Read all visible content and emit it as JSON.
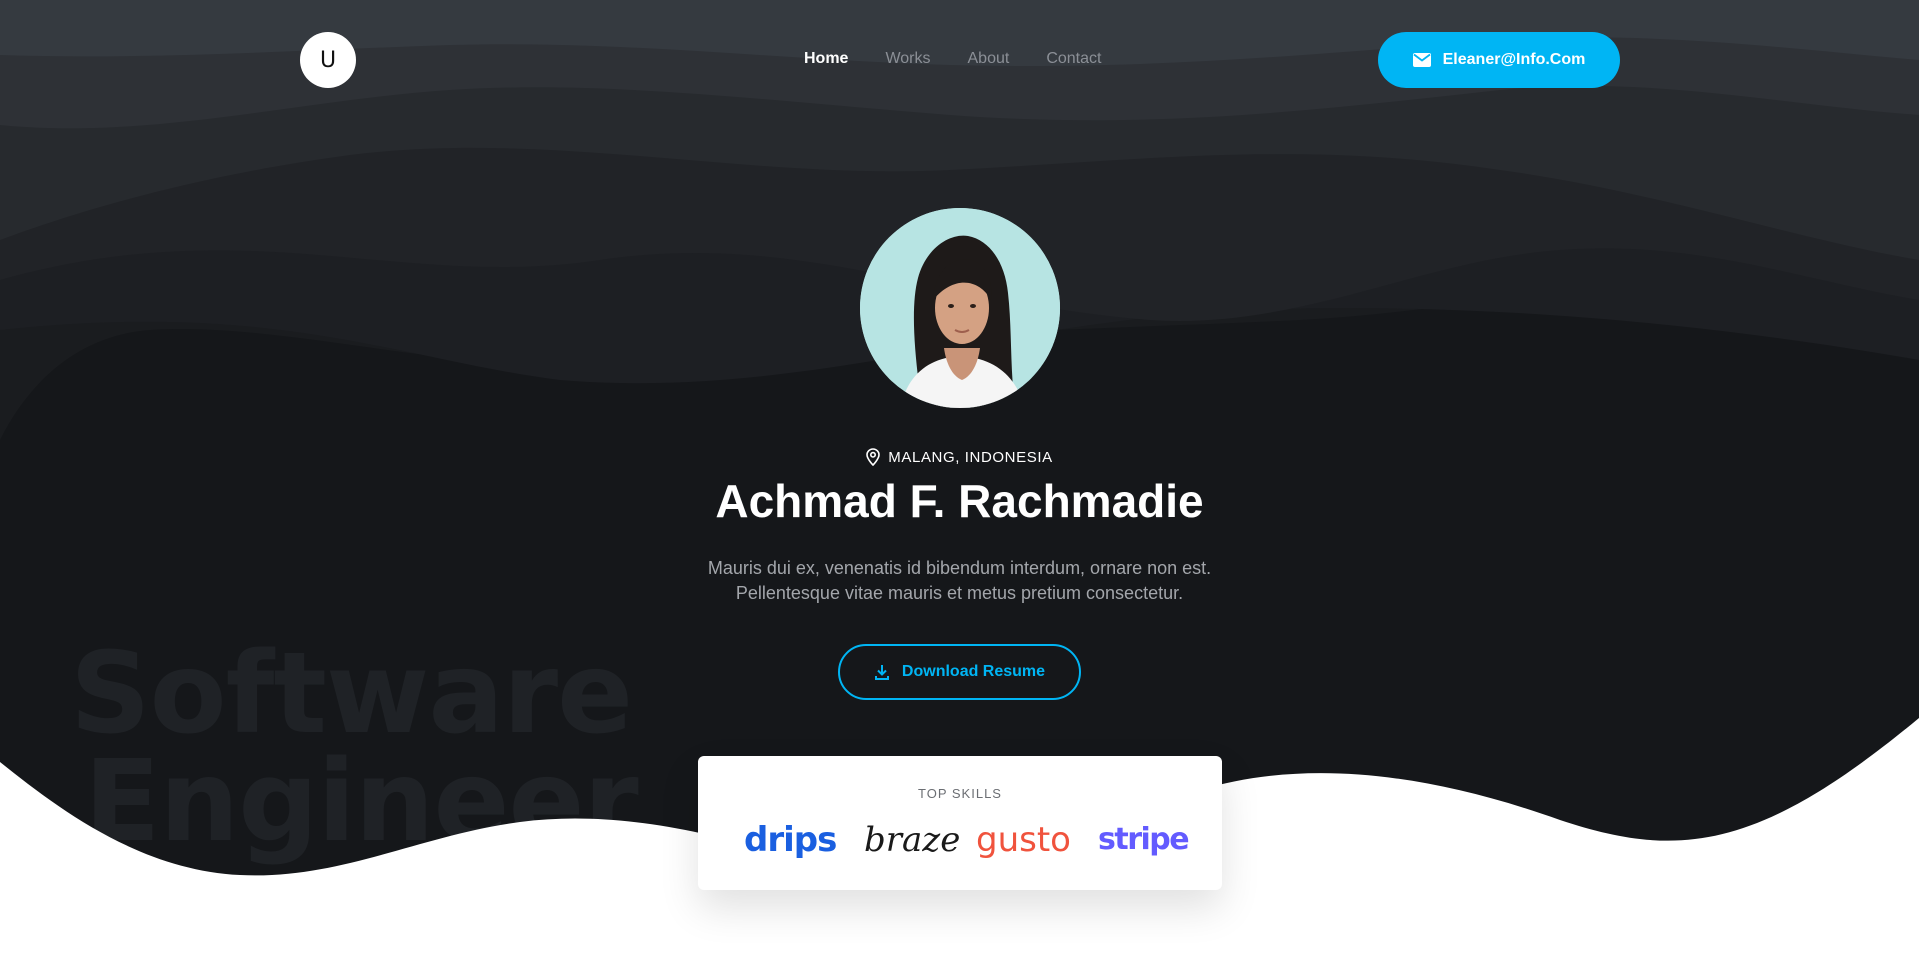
{
  "header": {
    "logo_text": "U",
    "nav": [
      {
        "label": "Home",
        "active": true
      },
      {
        "label": "Works",
        "active": false
      },
      {
        "label": "About",
        "active": false
      },
      {
        "label": "Contact",
        "active": false
      }
    ],
    "email_button": "Eleaner@Info.Com"
  },
  "profile": {
    "location": "MALANG, INDONESIA",
    "name": "Achmad F. Rachmadie",
    "bio_line1": "Mauris dui ex, venenatis id bibendum interdum, ornare non est.",
    "bio_line2": "Pellentesque vitae mauris et metus pretium consectetur.",
    "resume_button": "Download Resume"
  },
  "background": {
    "watermark_line1": "Software",
    "watermark_line2": "Engineer"
  },
  "skills": {
    "title": "TOP SKILLS",
    "logos": [
      "drips",
      "braze",
      "gusto",
      "stripe"
    ]
  },
  "colors": {
    "accent": "#00b5f4",
    "hero_dark": "#15171a",
    "drips": "#1a5fe0",
    "gusto": "#f0533d",
    "stripe": "#635bff"
  },
  "icons": [
    "envelope-icon",
    "location-pin-icon",
    "download-icon"
  ]
}
